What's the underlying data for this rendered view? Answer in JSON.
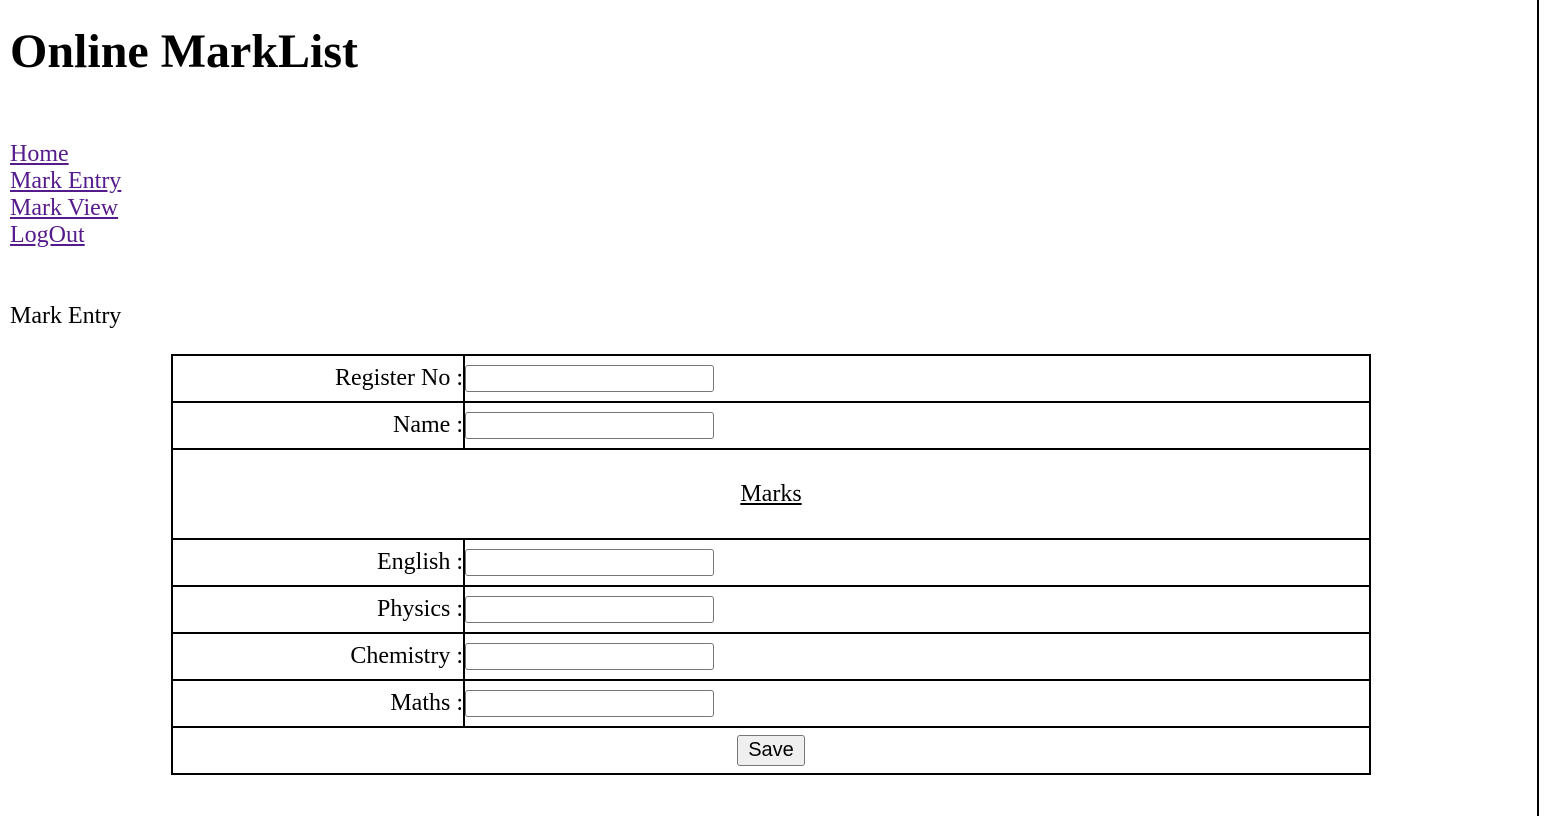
{
  "header": {
    "title": "Online MarkList"
  },
  "nav": {
    "items": [
      {
        "label": "Home"
      },
      {
        "label": "Mark Entry"
      },
      {
        "label": "Mark View"
      },
      {
        "label": "LogOut"
      }
    ]
  },
  "section": {
    "title": "Mark Entry"
  },
  "form": {
    "register_no": {
      "label": "Register No :",
      "value": ""
    },
    "name": {
      "label": "Name :",
      "value": ""
    },
    "marks_heading": "Marks",
    "english": {
      "label": "English :",
      "value": ""
    },
    "physics": {
      "label": "Physics :",
      "value": ""
    },
    "chemistry": {
      "label": "Chemistry :",
      "value": ""
    },
    "maths": {
      "label": "Maths :",
      "value": ""
    },
    "save_label": "Save"
  }
}
